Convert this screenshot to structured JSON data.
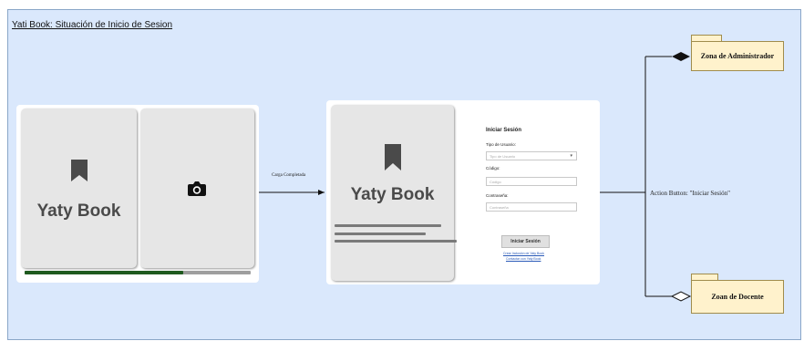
{
  "frame": {
    "title": "Yati Book: Situación de Inicio de Sesion"
  },
  "screen1": {
    "brand": "Yaty Book",
    "bookmark_icon": "bookmark-icon",
    "camera_icon": "camera-icon",
    "loading_progress": 0.7
  },
  "transition1": {
    "label": "Carga Completada"
  },
  "screen2": {
    "brand": "Yaty Book",
    "bookmark_icon": "bookmark-icon",
    "form": {
      "heading": "Iniciar Sesión",
      "user_type_label": "Tipo de Usuario:",
      "user_type_placeholder": "Tipo de Usuario",
      "code_label": "Código:",
      "code_placeholder": "Código",
      "password_label": "Contraseña:",
      "password_placeholder": "Contraseña",
      "submit_label": "Iniciar Sesión",
      "link_create": "Crear Inclusión de Yaty Book",
      "link_contact": "Contactar con Yaty Book"
    }
  },
  "transition2": {
    "label": "Action Button: \"Iniciar Sesión\""
  },
  "packages": {
    "admin": "Zona de Administrador",
    "teacher": "Zoan de Docente"
  },
  "colors": {
    "frame_bg": "#dae8fc",
    "package_fill": "#fff2cc",
    "progress": "#1f5a1f"
  }
}
